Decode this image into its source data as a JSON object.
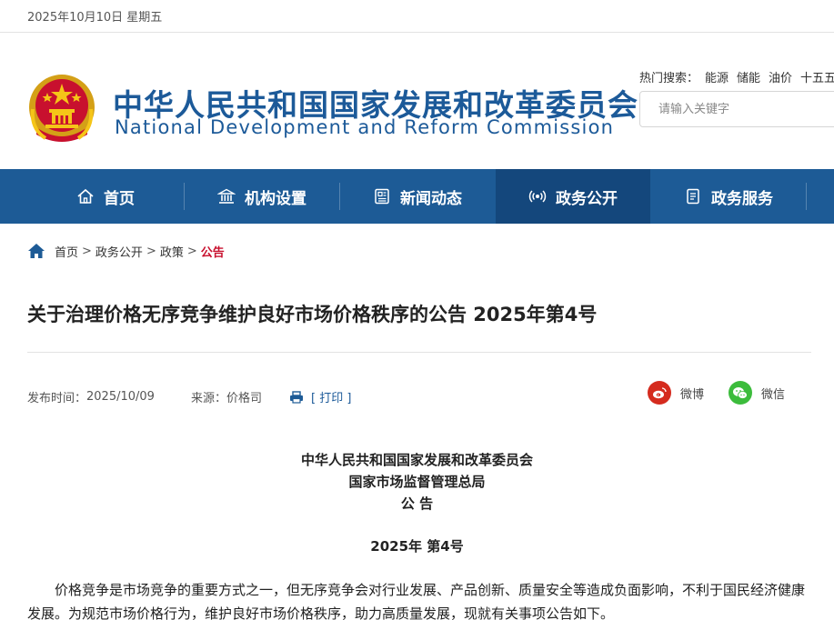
{
  "topbar": {
    "date": "2025年10月10日 星期五"
  },
  "header": {
    "title_cn": "中华人民共和国国家发展和改革委员会",
    "title_en": "National Development and Reform Commission",
    "hot_label": "热门搜索：",
    "hot_terms": [
      "能源",
      "储能",
      "油价",
      "十五五"
    ],
    "search_placeholder": "请输入关键字"
  },
  "nav": {
    "items": [
      {
        "label": "首页",
        "icon": "home-icon"
      },
      {
        "label": "机构设置",
        "icon": "institution-icon"
      },
      {
        "label": "新闻动态",
        "icon": "news-icon"
      },
      {
        "label": "政务公开",
        "icon": "broadcast-icon",
        "active": true
      },
      {
        "label": "政务服务",
        "icon": "service-icon"
      }
    ],
    "bg_color": "#1d5b96",
    "active_color": "#14477c"
  },
  "breadcrumb": {
    "items": [
      "首页",
      "政务公开",
      "政策"
    ],
    "separator": ">",
    "current": "公告"
  },
  "article": {
    "title": "关于治理价格无序竞争维护良好市场价格秩序的公告 2025年第4号",
    "publish_label": "发布时间：",
    "publish_date": "2025/10/09",
    "source_label": "来源：",
    "source": "价格司",
    "print_label": "[ 打印 ]",
    "issuers": [
      "中华人民共和国国家发展和改革委员会",
      "国家市场监督管理总局",
      "公 告"
    ],
    "doc_no": "2025年 第4号",
    "body": "价格竞争是市场竞争的重要方式之一，但无序竞争会对行业发展、产品创新、质量安全等造成负面影响，不利于国民经济健康发展。为规范市场价格行为，维护良好市场价格秩序，助力高质量发展，现就有关事项公告如下。"
  },
  "share": {
    "weibo": "微博",
    "wechat": "微信",
    "weibo_color": "#d52b1e",
    "wechat_color": "#3cbc3c"
  }
}
